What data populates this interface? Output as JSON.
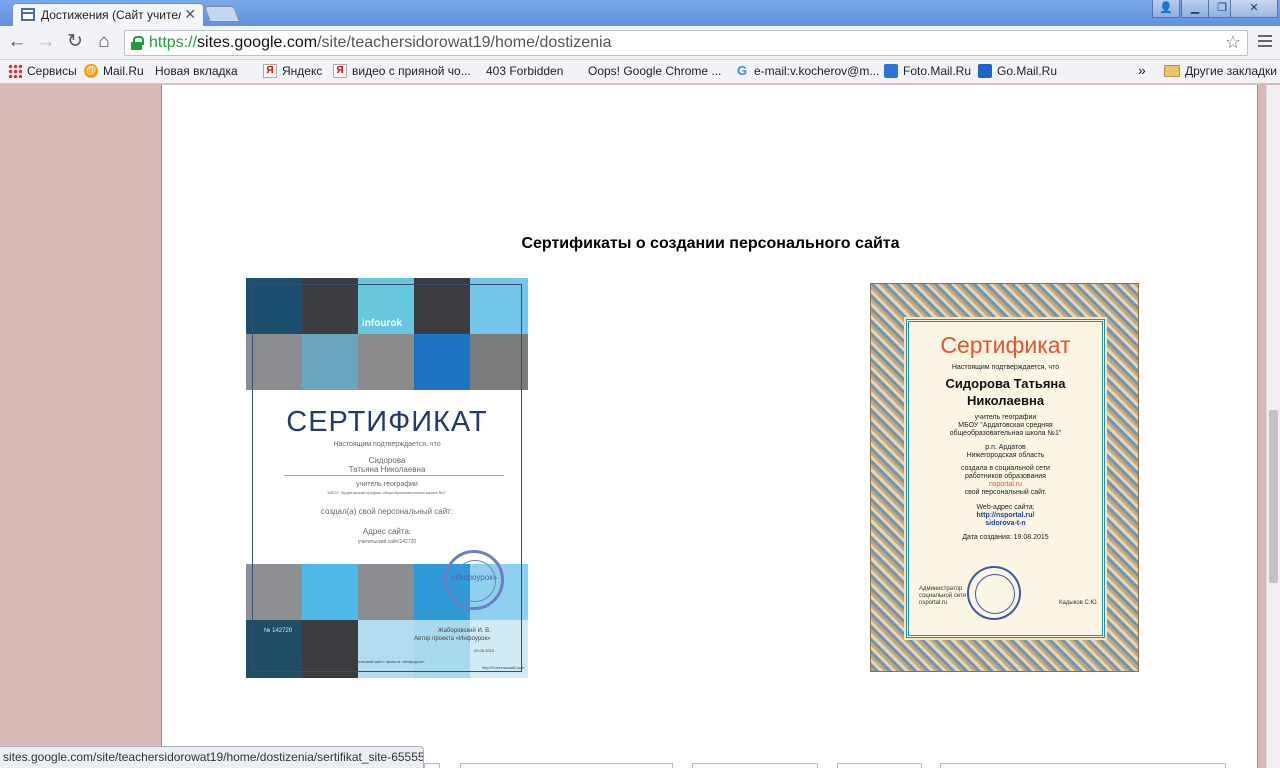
{
  "browser": {
    "tab_title": "Достижения (Сайт учителя",
    "tab_close": "✕",
    "url_scheme": "https://",
    "url_host": "sites.google.com",
    "url_path": "/site/teachersidorowat19/home/dostizenia",
    "window_controls": [
      "user-icon",
      "minimize-icon",
      "restore-icon",
      "close-icon"
    ]
  },
  "bookmarks": {
    "items": [
      {
        "label": "Сервисы",
        "icon": "apps-icon"
      },
      {
        "label": "Mail.Ru",
        "icon": "mailru-icon"
      },
      {
        "label": "Новая вкладка",
        "icon": "page-icon"
      },
      {
        "label": "Яндекс",
        "icon": "yandex-icon"
      },
      {
        "label": "видео с прияной чо...",
        "icon": "yandex-icon"
      },
      {
        "label": "403 Forbidden",
        "icon": "page-icon"
      },
      {
        "label": "Oops! Google Chrome ...",
        "icon": "page-icon"
      },
      {
        "label": "e-mail:v.kocherov@m...",
        "icon": "google-icon"
      },
      {
        "label": "Foto.Mail.Ru",
        "icon": "foto-icon"
      },
      {
        "label": "Go.Mail.Ru",
        "icon": "go-icon"
      }
    ],
    "overflow": "»",
    "other": "Другие закладки"
  },
  "page": {
    "heading": "Сертификаты о создании персонального сайта"
  },
  "cert1": {
    "logo": "infourok",
    "title": "СЕРТИФИКАТ",
    "confirm": "Настоящим подтверждается, что",
    "name1": "Сидорова",
    "name2": "Татьяна Николаевна",
    "position": "учитель географии",
    "school": "МБОУ \"Ардатовская средняя общеобразовательная школа №1\"",
    "created": "создал(а) свой персональный сайт:",
    "site_label": "Адрес сайта:",
    "site_value": "учительский.сайт/142720",
    "number": "№ 142720",
    "seal": "«Инфоурок»",
    "signer": "Жаборовский И. В.",
    "signer_role": "Автор проекта «Инфоурок»",
    "date": "20.06.2015",
    "footer1": "Сеть образовательных сайтов «Учительский сайт» проекта «Инфоурок»",
    "footer2": "http://Учительский.сайт"
  },
  "cert2": {
    "title": "Сертификат",
    "confirm": "Настоящим подтверждается, что",
    "name1": "Сидорова Татьяна",
    "name2": "Николаевна",
    "position": "учитель географии",
    "school1": "МБОУ \"Ардатовская средняя",
    "school2": "общеобразовательная школа №1\"",
    "place1": "р.п. Ардатов",
    "place2": "Нижегородская область",
    "created1": "создала в социальной сети",
    "created2": "работников образования",
    "network": "nsportal.ru",
    "created3": "свой персональный сайт.",
    "web_label": "Web-адрес сайта:",
    "web1": "http://nsportal.ru/",
    "web2": "sidorova-t-n",
    "date": "Дата создания: 19.08.2015",
    "admin1": "Администратор",
    "admin2": "социальной сети",
    "admin3": "nsportal.ru",
    "signer": "Кадыков С.Ю."
  },
  "status": {
    "link": "sites.google.com/site/teachersidorowat19/home/dostizenia/sertifikat_site-655556.pn..."
  }
}
